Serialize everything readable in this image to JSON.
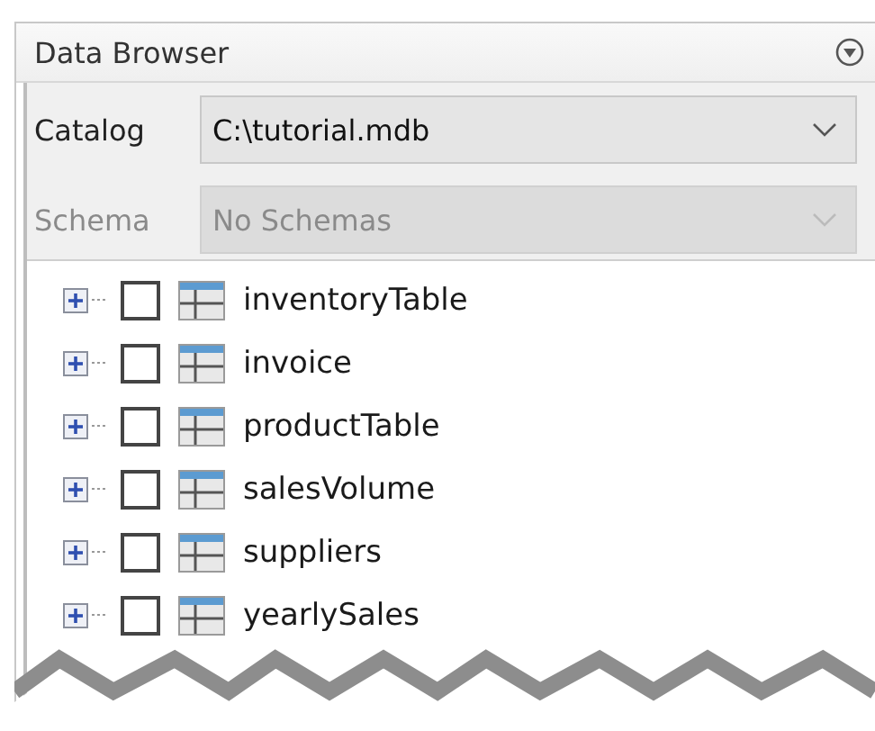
{
  "panel": {
    "title": "Data Browser"
  },
  "catalog": {
    "label": "Catalog",
    "value": "C:\\tutorial.mdb",
    "disabled": false
  },
  "schema": {
    "label": "Schema",
    "value": "No Schemas",
    "disabled": true
  },
  "tables": [
    {
      "name": "inventoryTable",
      "checked": false,
      "expanded": false
    },
    {
      "name": "invoice",
      "checked": false,
      "expanded": false
    },
    {
      "name": "productTable",
      "checked": false,
      "expanded": false
    },
    {
      "name": "salesVolume",
      "checked": false,
      "expanded": false
    },
    {
      "name": "suppliers",
      "checked": false,
      "expanded": false
    },
    {
      "name": "yearlySales",
      "checked": false,
      "expanded": false
    }
  ]
}
